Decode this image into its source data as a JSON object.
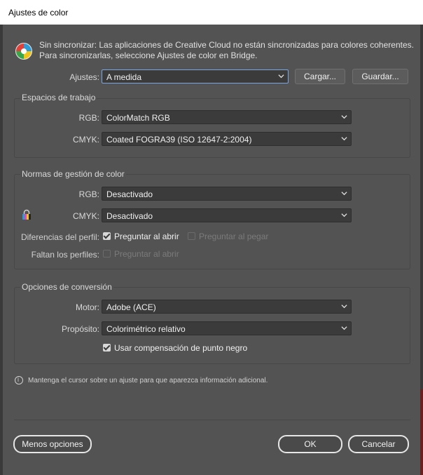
{
  "window": {
    "title": "Ajustes de color"
  },
  "sync": {
    "line1": "Sin sincronizar: Las aplicaciones de Creative Cloud no están sincronizadas para colores coherentes.",
    "line2": "Para sincronizarlas, seleccione Ajustes de color en Bridge."
  },
  "settings": {
    "label": "Ajustes:",
    "value": "A medida",
    "load_label": "Cargar...",
    "save_label": "Guardar..."
  },
  "workspaces": {
    "title": "Espacios de trabajo",
    "rgb_label": "RGB:",
    "rgb_value": "ColorMatch RGB",
    "cmyk_label": "CMYK:",
    "cmyk_value": "Coated FOGRA39 (ISO 12647-2:2004)"
  },
  "policies": {
    "title": "Normas de gestión de color",
    "rgb_label": "RGB:",
    "rgb_value": "Desactivado",
    "cmyk_label": "CMYK:",
    "cmyk_value": "Desactivado",
    "mismatch_label": "Diferencias del perfil:",
    "ask_open_label": "Preguntar al abrir",
    "ask_open_checked": true,
    "ask_paste_label": "Preguntar al pegar",
    "ask_paste_checked": false,
    "missing_label": "Faltan los perfiles:",
    "missing_ask_open_label": "Preguntar al abrir",
    "missing_ask_open_checked": false
  },
  "conversion": {
    "title": "Opciones de conversión",
    "engine_label": "Motor:",
    "engine_value": "Adobe (ACE)",
    "intent_label": "Propósito:",
    "intent_value": "Colorimétrico relativo",
    "bpc_label": "Usar compensación de punto negro",
    "bpc_checked": true
  },
  "info": {
    "text": "Mantenga el cursor sobre un ajuste para que aparezca información adicional."
  },
  "footer": {
    "fewer_label": "Menos opciones",
    "ok_label": "OK",
    "cancel_label": "Cancelar"
  }
}
